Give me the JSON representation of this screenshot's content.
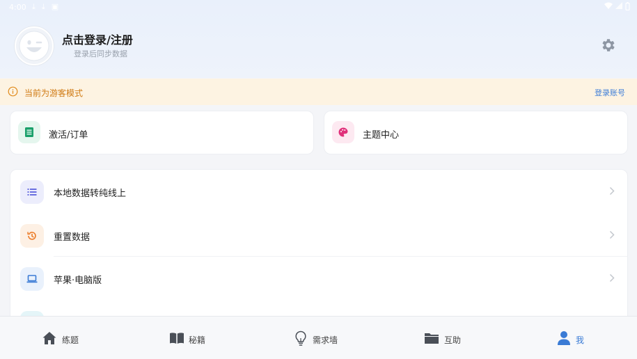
{
  "status_bar": {
    "time": "4:00",
    "icons_left": [
      "download-icon",
      "download-icon",
      "app-icon"
    ],
    "icons_right": [
      "wifi-icon",
      "signal-icon",
      "battery-icon"
    ]
  },
  "profile": {
    "title": "点击登录/注册",
    "subtitle": "登录后同步数据",
    "avatar_icon": "smiley-wink-icon",
    "settings_icon": "gear-icon"
  },
  "guest_bar": {
    "icon": "info-icon",
    "text": "当前为游客模式",
    "action": "登录账号",
    "text_color": "#d07a12",
    "action_color": "#3e7ed8"
  },
  "cards": [
    {
      "label": "激活/订单",
      "icon": "document-list-icon",
      "color": "#1aa06a",
      "bg": "#e5f6ee"
    },
    {
      "label": "主题中心",
      "icon": "palette-icon",
      "color": "#e0307a",
      "bg": "#fde9f1"
    }
  ],
  "menu": [
    {
      "label": "本地数据转纯线上",
      "icon": "list-icon",
      "color": "#6a6fe0",
      "bg": "#ecedfc"
    },
    {
      "label": "重置数据",
      "icon": "history-icon",
      "color": "#ec7d2a",
      "bg": "#fdf0e4"
    },
    {
      "label": "苹果·电脑版",
      "icon": "laptop-icon",
      "color": "#3a7bd5",
      "bg": "#e9f1fc"
    },
    {
      "label": "",
      "icon": "partial-icon",
      "color": "#4fb6c9",
      "bg": "#e4f5f8"
    }
  ],
  "tabs": [
    {
      "label": "练题",
      "icon": "home-icon",
      "active": false
    },
    {
      "label": "秘籍",
      "icon": "book-icon",
      "active": false
    },
    {
      "label": "需求墙",
      "icon": "lightbulb-icon",
      "active": false
    },
    {
      "label": "互助",
      "icon": "folder-icon",
      "active": false
    },
    {
      "label": "我",
      "icon": "person-icon",
      "active": true
    }
  ],
  "colors": {
    "accent": "#3a7bd5",
    "header_bg": "#e9f0fb",
    "guest_bg": "#fdf3e2"
  }
}
